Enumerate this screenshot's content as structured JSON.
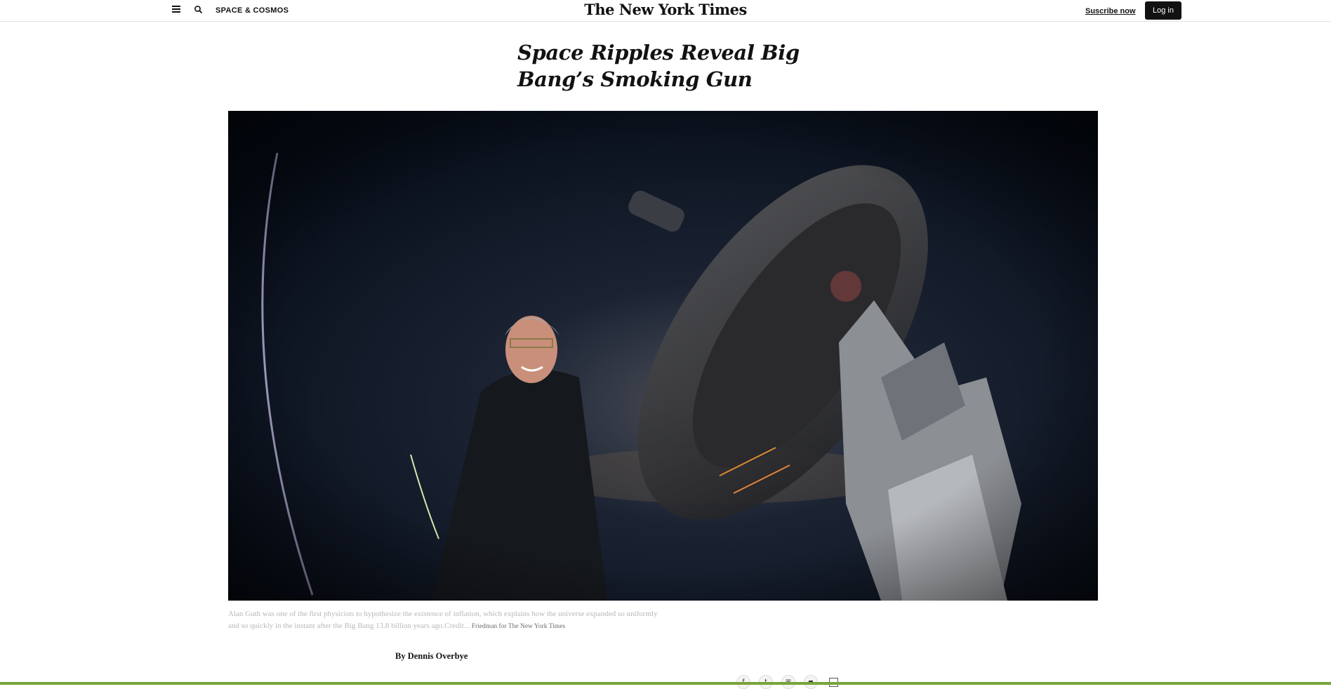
{
  "header": {
    "section": "SPACE & COSMOS",
    "logo": "The New York Times",
    "subscribe_label": "Suscribe now",
    "login_label": "Log in"
  },
  "article": {
    "headline": "Space Ripples Reveal Big Bang’s Smoking Gun",
    "caption": "Alan Guth was one of the first physicists to hypothesize the existence of inflation, which explains how the universe expanded so uniformly and so quickly in the instant after the Big Bang 13.8 billion years ago.",
    "credit_prefix": "Credit...",
    "credit": "Friedman for The New York Times",
    "byline": "By Dennis Overbye"
  },
  "share": {
    "facebook_glyph": "f",
    "twitter_glyph": "t",
    "email_glyph": "✉",
    "share_glyph": "➦"
  },
  "icons": [
    "menu-icon",
    "search-icon",
    "facebook-icon",
    "twitter-icon",
    "email-icon",
    "share-icon",
    "bookmark-icon"
  ],
  "colors": {
    "text": "#121212",
    "caption": "#b8b8b8",
    "progress": "#7aa33a",
    "photo_bg": "#07101d"
  }
}
